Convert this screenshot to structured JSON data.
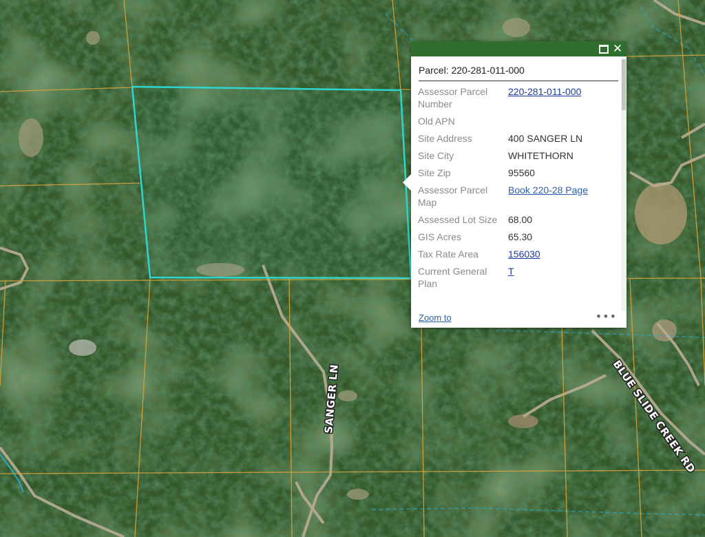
{
  "map": {
    "road_labels": [
      "SANGER LN",
      "BLUE SLIDE CREEK RD"
    ],
    "colors": {
      "parcel_highlight": "#2fd6cf",
      "parcel_lines": "#d9a53a",
      "roads": "#b9ad93",
      "streams": "#2aa8c8"
    }
  },
  "popup": {
    "title": "Parcel: 220-281-011-000",
    "header_buttons": [
      "maximize-icon",
      "close-icon"
    ],
    "fields": [
      {
        "label": "Assessor Parcel Number",
        "value": "220-281-011-000",
        "link": true
      },
      {
        "label": "Old APN",
        "value": "",
        "link": false
      },
      {
        "label": "Site Address",
        "value": "400 SANGER LN",
        "link": false
      },
      {
        "label": "Site City",
        "value": "WHITETHORN",
        "link": false
      },
      {
        "label": "Site Zip",
        "value": "95560",
        "link": false
      },
      {
        "label": "Assessor Parcel Map",
        "value": "Book 220-28 Page",
        "link": true
      },
      {
        "label": "Assessed Lot Size",
        "value": "68.00",
        "link": false
      },
      {
        "label": "GIS Acres",
        "value": "65.30",
        "link": false
      },
      {
        "label": "Tax Rate Area",
        "value": "156030",
        "link": true
      },
      {
        "label": "Current General Plan",
        "value": "T",
        "link": true
      }
    ],
    "footer": {
      "zoom_label": "Zoom to",
      "more_icon": "•••"
    },
    "header_color": "#2f6e2c"
  }
}
